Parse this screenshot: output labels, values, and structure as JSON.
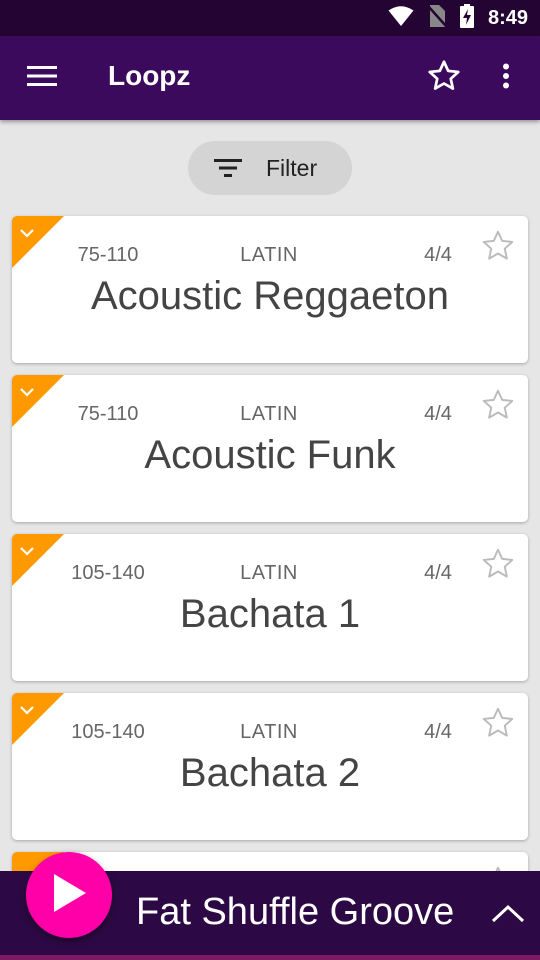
{
  "status_bar": {
    "time": "8:49",
    "icons": [
      "wifi-icon",
      "no-sim-icon",
      "battery-charging-icon"
    ]
  },
  "app_bar": {
    "title": "Loopz",
    "icons": [
      "menu-icon",
      "star-outline-icon",
      "more-vert-icon"
    ]
  },
  "filter": {
    "label": "Filter",
    "icon": "filter-list-icon"
  },
  "loops": [
    {
      "tempo": "75-110",
      "genre": "LATIN",
      "meter": "4/4",
      "name": "Acoustic Reggaeton"
    },
    {
      "tempo": "75-110",
      "genre": "LATIN",
      "meter": "4/4",
      "name": "Acoustic Funk"
    },
    {
      "tempo": "105-140",
      "genre": "LATIN",
      "meter": "4/4",
      "name": "Bachata 1"
    },
    {
      "tempo": "105-140",
      "genre": "LATIN",
      "meter": "4/4",
      "name": "Bachata 2"
    }
  ],
  "player": {
    "now_playing": "Fat Shuffle Groove",
    "icons": [
      "play-icon",
      "chevron-up-icon"
    ]
  },
  "colors": {
    "status_bar": "#240433",
    "app_bar": "#3b0a5c",
    "player_bar": "#2c0944",
    "play_button": "#ff00a8",
    "corner_tag": "#ff9900",
    "background": "#e6e6e6"
  }
}
